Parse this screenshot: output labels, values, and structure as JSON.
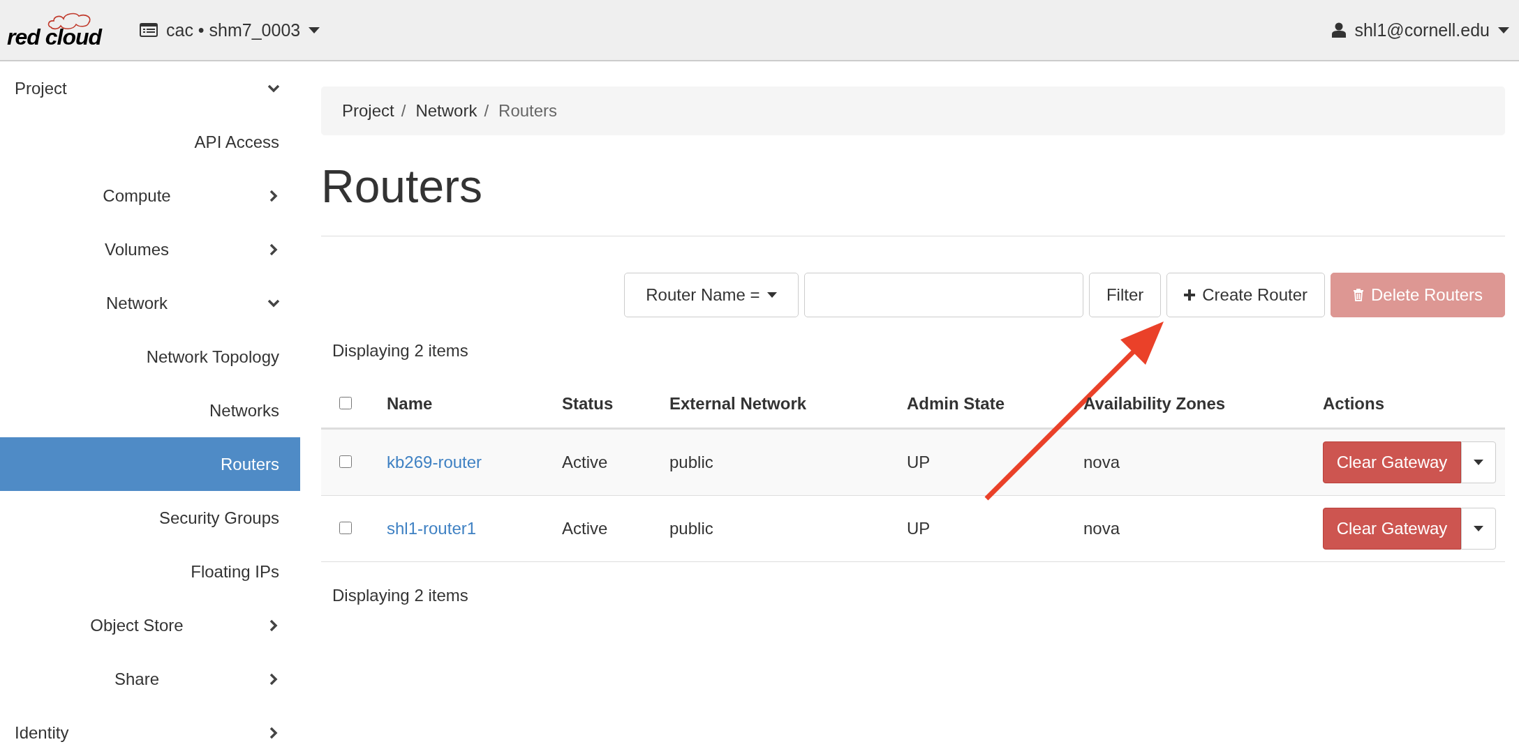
{
  "header": {
    "logo": "red cloud",
    "project": "cac • shm7_0003",
    "user": "shl1@cornell.edu"
  },
  "sidebar": {
    "items": [
      {
        "label": "Project",
        "kind": "panel",
        "expanded": true,
        "children": [
          {
            "label": "API Access",
            "kind": "link",
            "selected": false
          },
          {
            "label": "Compute",
            "kind": "group",
            "expanded": false
          },
          {
            "label": "Volumes",
            "kind": "group",
            "expanded": false
          },
          {
            "label": "Network",
            "kind": "group",
            "expanded": true,
            "children": [
              {
                "label": "Network Topology",
                "kind": "link",
                "selected": false
              },
              {
                "label": "Networks",
                "kind": "link",
                "selected": false
              },
              {
                "label": "Routers",
                "kind": "link",
                "selected": true
              },
              {
                "label": "Security Groups",
                "kind": "link",
                "selected": false
              },
              {
                "label": "Floating IPs",
                "kind": "link",
                "selected": false
              }
            ]
          },
          {
            "label": "Object Store",
            "kind": "group",
            "expanded": false
          },
          {
            "label": "Share",
            "kind": "group",
            "expanded": false
          }
        ]
      },
      {
        "label": "Identity",
        "kind": "panel",
        "expanded": false
      }
    ]
  },
  "breadcrumb": {
    "separator": "/",
    "items": [
      "Project",
      "Network",
      "Routers"
    ]
  },
  "title": "Routers",
  "toolbar": {
    "filter_field": "Router Name =",
    "filter": "Filter",
    "create": "Create Router",
    "delete": {
      "label": "Delete Routers",
      "disabled": true
    }
  },
  "count_top": "Displaying 2 items",
  "table": {
    "select_all": {
      "checked": false
    },
    "columns": [
      "Name",
      "Status",
      "External Network",
      "Admin State",
      "Availability Zones",
      "Actions"
    ],
    "rows": [
      {
        "checked": false,
        "name": "kb269-router",
        "status": "Active",
        "external_network": "public",
        "admin_state": "UP",
        "zone": "nova",
        "action": "Clear Gateway"
      },
      {
        "checked": false,
        "name": "shl1-router1",
        "status": "Active",
        "external_network": "public",
        "admin_state": "UP",
        "zone": "nova",
        "action": "Clear Gateway"
      }
    ]
  },
  "count_bottom": "Displaying 2 items"
}
